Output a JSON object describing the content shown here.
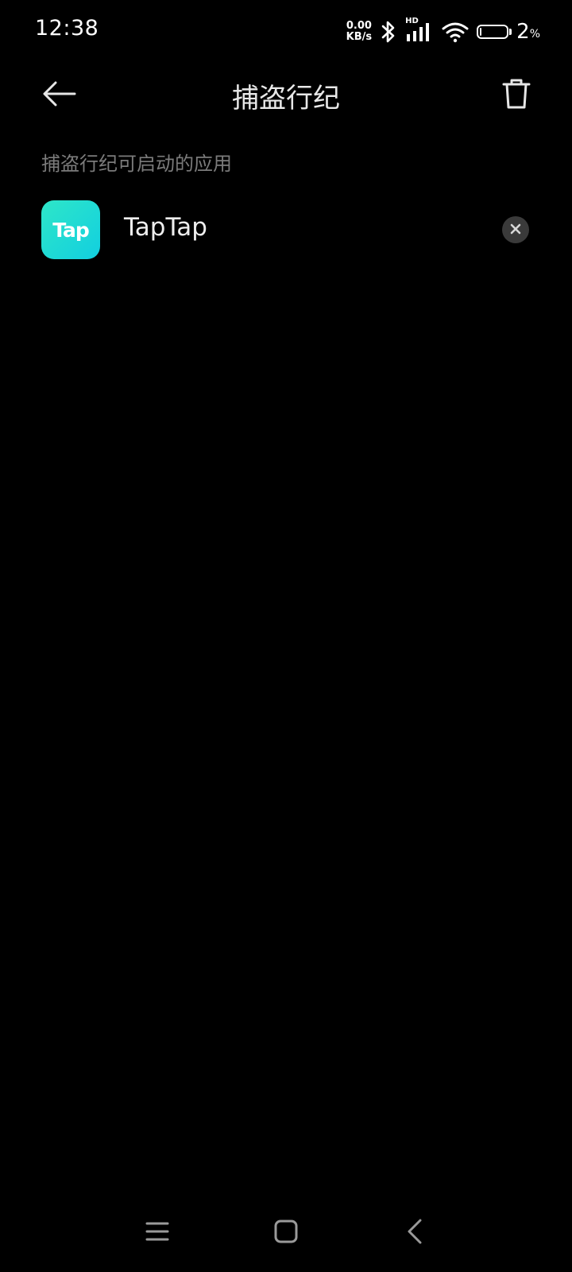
{
  "status_bar": {
    "time": "12:38",
    "net_speed_value": "0.00",
    "net_speed_unit": "KB/s",
    "signal_label": "HD",
    "battery_level": "2",
    "battery_percent_sign": "%",
    "icons": [
      "bluetooth-icon",
      "signal-icon",
      "wifi-icon",
      "battery-icon"
    ]
  },
  "header": {
    "title": "捕盗行纪",
    "back_icon": "back-arrow-icon",
    "delete_icon": "trash-icon"
  },
  "section": {
    "label": "捕盗行纪可启动的应用"
  },
  "apps": [
    {
      "name": "TapTap",
      "icon_text": "Tap",
      "icon_colors": [
        "#2ee6c8",
        "#12cfe0"
      ]
    }
  ],
  "nav_bar": {
    "icons": [
      "menu-icon",
      "home-icon",
      "back-icon"
    ]
  },
  "colors": {
    "background": "#000000",
    "secondary_text": "#7b7b7b",
    "remove_button_bg": "#3a3a3a"
  }
}
